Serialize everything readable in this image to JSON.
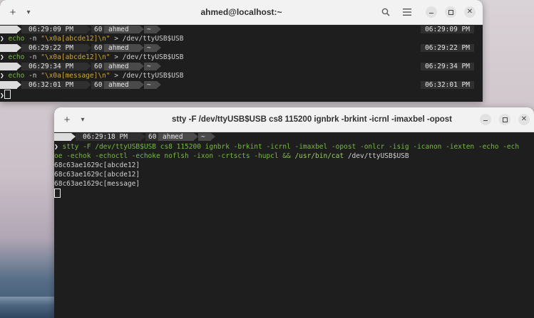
{
  "window1": {
    "title": "ahmed@localhost:~",
    "new_tab": "+",
    "menu": "▾",
    "lines": [
      {
        "type": "prompt",
        "time": "06:29:09 PM",
        "n": "60",
        "user": "ahmed",
        "dir": "~",
        "rtime": "06:29:09 PM"
      },
      {
        "type": "cmd",
        "parts": [
          "echo",
          " -n ",
          "\"\\x0a[abcde12]\\n\"",
          " > /dev/ttyUSB$USB"
        ]
      },
      {
        "type": "prompt",
        "time": "06:29:22 PM",
        "n": "60",
        "user": "ahmed",
        "dir": "~",
        "rtime": "06:29:22 PM"
      },
      {
        "type": "cmd",
        "parts": [
          "echo",
          " -n ",
          "\"\\x0a[abcde12]\\n\"",
          " > /dev/ttyUSB$USB"
        ]
      },
      {
        "type": "prompt",
        "time": "06:29:34 PM",
        "n": "60",
        "user": "ahmed",
        "dir": "~",
        "rtime": "06:29:34 PM"
      },
      {
        "type": "cmd",
        "parts": [
          "echo",
          " -n ",
          "\"\\x0a[message]\\n\"",
          " > /dev/ttyUSB$USB"
        ]
      },
      {
        "type": "prompt",
        "time": "06:32:01 PM",
        "n": "60",
        "user": "ahmed",
        "dir": "~",
        "rtime": "06:32:01 PM"
      }
    ]
  },
  "window2": {
    "title": "stty -F /dev/ttyUSB$USB cs8 115200 ignbrk -brkint -icrnl -imaxbel -opost",
    "new_tab": "+",
    "menu": "▾",
    "prompt": {
      "time": "06:29:18 PM",
      "n": "60",
      "user": "ahmed",
      "dir": "~"
    },
    "cmd_part1": "stty -F /dev/ttyUSB$USB cs8 115200 ignbrk -brkint -icrnl -imaxbel -opost -onlcr -isig -icanon -iexten -echo -ech",
    "cmd_part2a": "oe -echok -echoctl -echoke noflsh -ixon -crtscts -hupcl && ",
    "cmd_path": "/usr/bin/cat",
    "cmd_part2b": " /dev/ttyUSB$USB",
    "output": [
      "68c63ae1629c[abcde12]",
      "68c63ae1629c[abcde12]",
      "68c63ae1629c[message]"
    ]
  },
  "prompt_symbol": "❯",
  "colors": {
    "echo_green": "#78b942",
    "string_yellow": "#c9a53a",
    "terminal_bg": "#1e1e1e",
    "titlebar": "#f2f2f2"
  }
}
